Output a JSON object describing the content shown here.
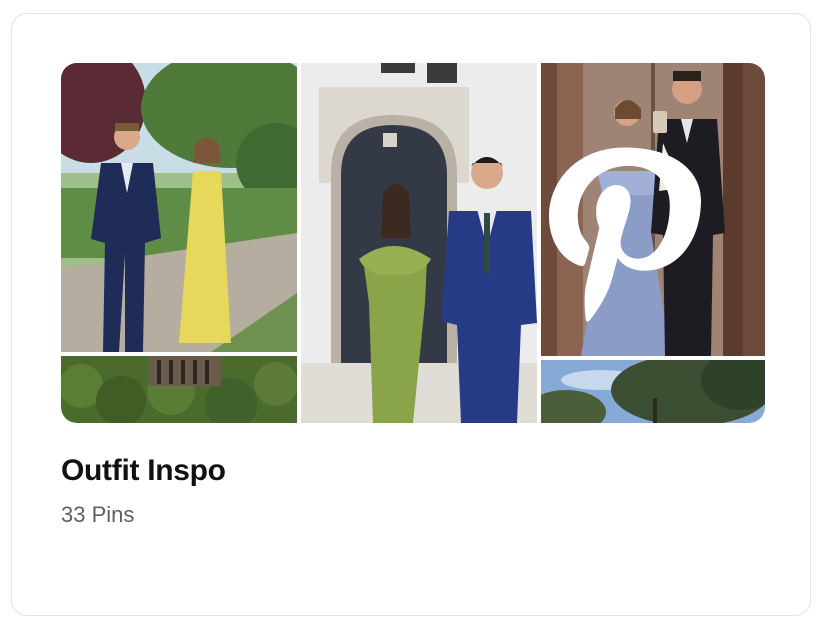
{
  "board": {
    "title": "Outfit Inspo",
    "pin_count_label": "33 Pins"
  },
  "icons": {
    "pinterest": "pinterest-logo-icon"
  },
  "colors": {
    "title": "#111111",
    "subtitle": "#5f5f5f",
    "card_border": "#e3e3e3"
  }
}
